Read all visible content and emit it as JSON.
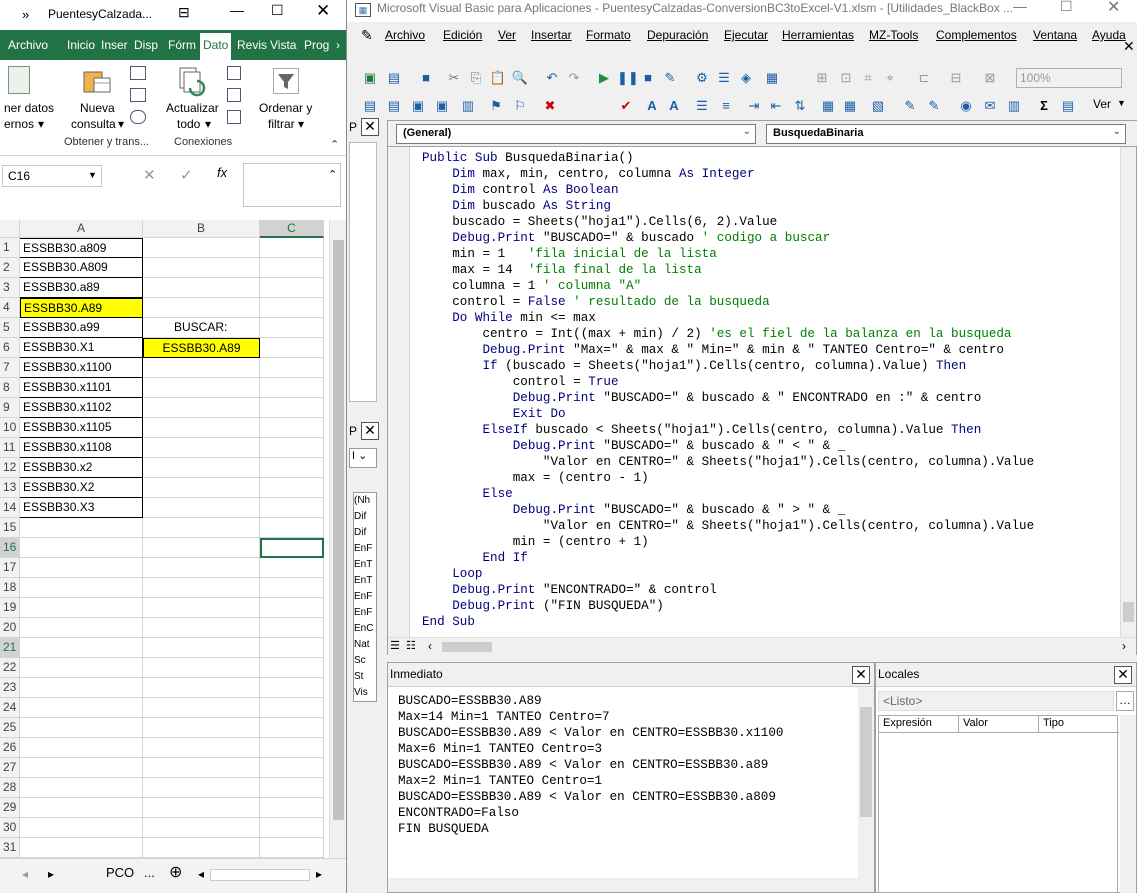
{
  "excel": {
    "title": "PuentesyCalzada...",
    "tabs": [
      "Archivo",
      "Inicio",
      "Inser",
      "Disp",
      "Fórm",
      "Dato",
      "Revis",
      "Vista",
      "Prog"
    ],
    "ribbon": {
      "left_label_1": "ner datos",
      "left_label_2": "ernos",
      "nueva_consulta_1": "Nueva",
      "nueva_consulta_2": "consulta",
      "actualizar_1": "Actualizar",
      "actualizar_2": "todo",
      "ordenar_1": "Ordenar y",
      "ordenar_2": "filtrar",
      "group_obtener": "Obtener y trans...",
      "group_conexiones": "Conexiones"
    },
    "name_box": "C16",
    "columns": [
      "A",
      "B",
      "C"
    ],
    "rows": [
      {
        "n": "1",
        "a": "ESSBB30.a809",
        "b": ""
      },
      {
        "n": "2",
        "a": "ESSBB30.A809",
        "b": ""
      },
      {
        "n": "3",
        "a": "ESSBB30.a89",
        "b": ""
      },
      {
        "n": "4",
        "a": "ESSBB30.A89",
        "b": ""
      },
      {
        "n": "5",
        "a": "ESSBB30.a99",
        "b": "BUSCAR:"
      },
      {
        "n": "6",
        "a": "ESSBB30.X1",
        "b": "ESSBB30.A89"
      },
      {
        "n": "7",
        "a": "ESSBB30.x1100",
        "b": ""
      },
      {
        "n": "8",
        "a": "ESSBB30.x1101",
        "b": ""
      },
      {
        "n": "9",
        "a": "ESSBB30.x1102",
        "b": ""
      },
      {
        "n": "10",
        "a": "ESSBB30.x1105",
        "b": ""
      },
      {
        "n": "11",
        "a": "ESSBB30.x1108",
        "b": ""
      },
      {
        "n": "12",
        "a": "ESSBB30.x2",
        "b": ""
      },
      {
        "n": "13",
        "a": "ESSBB30.X2",
        "b": ""
      },
      {
        "n": "14",
        "a": "ESSBB30.X3",
        "b": ""
      },
      {
        "n": "15",
        "a": "",
        "b": ""
      },
      {
        "n": "16",
        "a": "",
        "b": ""
      },
      {
        "n": "17",
        "a": "",
        "b": ""
      },
      {
        "n": "18",
        "a": "",
        "b": ""
      },
      {
        "n": "19",
        "a": "",
        "b": ""
      },
      {
        "n": "20",
        "a": "",
        "b": ""
      },
      {
        "n": "21",
        "a": "",
        "b": ""
      },
      {
        "n": "22",
        "a": "",
        "b": ""
      },
      {
        "n": "23",
        "a": "",
        "b": ""
      },
      {
        "n": "24",
        "a": "",
        "b": ""
      },
      {
        "n": "25",
        "a": "",
        "b": ""
      },
      {
        "n": "26",
        "a": "",
        "b": ""
      },
      {
        "n": "27",
        "a": "",
        "b": ""
      },
      {
        "n": "28",
        "a": "",
        "b": ""
      },
      {
        "n": "29",
        "a": "",
        "b": ""
      },
      {
        "n": "30",
        "a": "",
        "b": ""
      },
      {
        "n": "31",
        "a": "",
        "b": ""
      }
    ],
    "highlight_color": "#ffff00",
    "sheet_tab": "PCO",
    "sheet_more": "..."
  },
  "vbe": {
    "title": "Microsoft Visual Basic para Aplicaciones - PuentesyCalzadas-ConversionBC3toExcel-V1.xlsm - [Utilidades_BlackBox ...",
    "menu": [
      "Archivo",
      "Edición",
      "Ver",
      "Insertar",
      "Formato",
      "Depuración",
      "Ejecutar",
      "Herramientas",
      "MZ-Tools",
      "Complementos",
      "Ventana",
      "Ayuda"
    ],
    "zoom": "100%",
    "ver_label": "Ver",
    "combo_object": "(General)",
    "combo_proc": "BusquedaBinaria",
    "project_items": [
      "(Nh",
      "Dif",
      "Dif",
      "EnF",
      "EnT",
      "EnT",
      "EnF",
      "EnF",
      "EnC",
      "Nat",
      "Sc",
      "St",
      "Vis"
    ],
    "code_lines": [
      [
        [
          "kw",
          "Public Sub "
        ],
        [
          "n",
          "BusquedaBinaria()"
        ]
      ],
      [
        [
          "n",
          "    "
        ],
        [
          "kw",
          "Dim "
        ],
        [
          "n",
          "max, min, centro, columna "
        ],
        [
          "kw",
          "As Integer"
        ]
      ],
      [
        [
          "n",
          "    "
        ],
        [
          "kw",
          "Dim "
        ],
        [
          "n",
          "control "
        ],
        [
          "kw",
          "As Boolean"
        ]
      ],
      [
        [
          "n",
          "    "
        ],
        [
          "kw",
          "Dim "
        ],
        [
          "n",
          "buscado "
        ],
        [
          "kw",
          "As String"
        ]
      ],
      [
        [
          "n",
          "    buscado = Sheets(\"hoja1\").Cells(6, 2).Value"
        ]
      ],
      [
        [
          "n",
          "    "
        ],
        [
          "kw",
          "Debug.Print "
        ],
        [
          "n",
          "\"BUSCADO=\" & buscado "
        ],
        [
          "cm",
          "' codigo a buscar"
        ]
      ],
      [
        [
          "n",
          "    min = 1   "
        ],
        [
          "cm",
          "'fila inicial de la lista"
        ]
      ],
      [
        [
          "n",
          "    max = 14  "
        ],
        [
          "cm",
          "'fila final de la lista"
        ]
      ],
      [
        [
          "n",
          "    columna = 1 "
        ],
        [
          "cm",
          "' columna \"A\""
        ]
      ],
      [
        [
          "n",
          "    control = "
        ],
        [
          "kw",
          "False "
        ],
        [
          "cm",
          "' resultado de la busqueda"
        ]
      ],
      [
        [
          "n",
          "    "
        ],
        [
          "kw",
          "Do While "
        ],
        [
          "n",
          "min <= max"
        ]
      ],
      [
        [
          "n",
          "        centro = Int((max + min) / 2) "
        ],
        [
          "cm",
          "'es el fiel de la balanza en la busqueda"
        ]
      ],
      [
        [
          "n",
          "        "
        ],
        [
          "kw",
          "Debug.Print "
        ],
        [
          "n",
          "\"Max=\" & max & \" Min=\" & min & \" TANTEO Centro=\" & centro"
        ]
      ],
      [
        [
          "n",
          "        "
        ],
        [
          "kw",
          "If "
        ],
        [
          "n",
          "(buscado = Sheets(\"hoja1\").Cells(centro, columna).Value) "
        ],
        [
          "kw",
          "Then"
        ]
      ],
      [
        [
          "n",
          "            control = "
        ],
        [
          "kw",
          "True"
        ]
      ],
      [
        [
          "n",
          "            "
        ],
        [
          "kw",
          "Debug.Print "
        ],
        [
          "n",
          "\"BUSCADO=\" & buscado & \" ENCONTRADO en :\" & centro"
        ]
      ],
      [
        [
          "n",
          "            "
        ],
        [
          "kw",
          "Exit Do"
        ]
      ],
      [
        [
          "n",
          "        "
        ],
        [
          "kw",
          "ElseIf "
        ],
        [
          "n",
          "buscado < Sheets(\"hoja1\").Cells(centro, columna).Value "
        ],
        [
          "kw",
          "Then"
        ]
      ],
      [
        [
          "n",
          "            "
        ],
        [
          "kw",
          "Debug.Print "
        ],
        [
          "n",
          "\"BUSCADO=\" & buscado & \" < \" & _"
        ]
      ],
      [
        [
          "n",
          "                \"Valor en CENTRO=\" & Sheets(\"hoja1\").Cells(centro, columna).Value"
        ]
      ],
      [
        [
          "n",
          "            max = (centro - 1)"
        ]
      ],
      [
        [
          "n",
          "        "
        ],
        [
          "kw",
          "Else"
        ]
      ],
      [
        [
          "n",
          "            "
        ],
        [
          "kw",
          "Debug.Print "
        ],
        [
          "n",
          "\"BUSCADO=\" & buscado & \" > \" & _"
        ]
      ],
      [
        [
          "n",
          "                \"Valor en CENTRO=\" & Sheets(\"hoja1\").Cells(centro, columna).Value"
        ]
      ],
      [
        [
          "n",
          "            min = (centro + 1)"
        ]
      ],
      [
        [
          "n",
          "        "
        ],
        [
          "kw",
          "End If"
        ]
      ],
      [
        [
          "n",
          "    "
        ],
        [
          "kw",
          "Loop"
        ]
      ],
      [
        [
          "n",
          "    "
        ],
        [
          "kw",
          "Debug.Print "
        ],
        [
          "n",
          "\"ENCONTRADO=\" & control"
        ]
      ],
      [
        [
          "n",
          "    "
        ],
        [
          "kw",
          "Debug.Print "
        ],
        [
          "n",
          "(\"FIN BUSQUEDA\")"
        ]
      ],
      [
        [
          "kw",
          "End Sub"
        ]
      ]
    ],
    "immediate_title": "Inmediato",
    "immediate_lines": [
      "BUSCADO=ESSBB30.A89",
      "Max=14 Min=1 TANTEO Centro=7",
      "BUSCADO=ESSBB30.A89 < Valor en CENTRO=ESSBB30.x1100",
      "Max=6 Min=1 TANTEO Centro=3",
      "BUSCADO=ESSBB30.A89 < Valor en CENTRO=ESSBB30.a89",
      "Max=2 Min=1 TANTEO Centro=1",
      "BUSCADO=ESSBB30.A89 < Valor en CENTRO=ESSBB30.a809",
      "ENCONTRADO=Falso",
      "FIN BUSQUEDA"
    ],
    "locals_title": "Locales",
    "locals_status": "<Listo>",
    "locals_cols": [
      "Expresión",
      "Valor",
      "Tipo"
    ],
    "colors": {
      "keyword": "#00007f",
      "comment": "#007f00"
    }
  }
}
